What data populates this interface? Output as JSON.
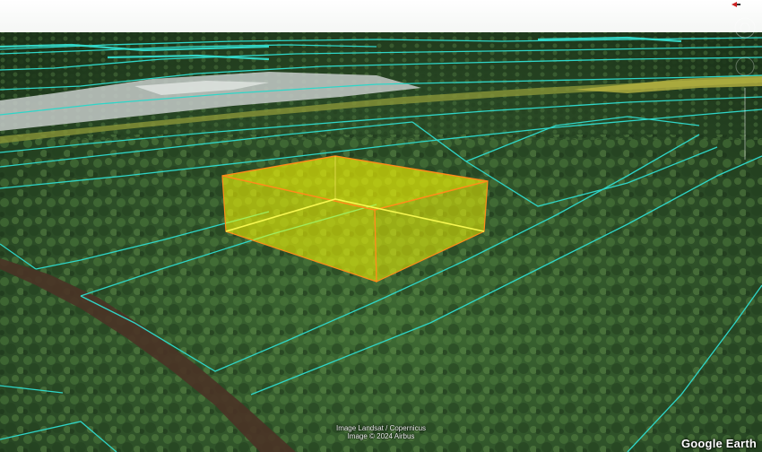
{
  "map": {
    "attribution_line1": "Image Landsat / Copernicus",
    "attribution_line2": "Image © 2024 Airbus",
    "logo": "Google Earth"
  },
  "colors": {
    "parcel_lines": "#2fd6c8",
    "extrusion_fill": "#ffff00",
    "extrusion_edge": "#ff8c1a",
    "vegetation_dark": "#1f3a1d",
    "vegetation_light": "#3f6b33",
    "clearing": "#c9cfd0",
    "road": "#5a3a2e"
  },
  "icons": {
    "compass": "north-arrow-icon",
    "navigation": "navigation-controls-icon"
  }
}
